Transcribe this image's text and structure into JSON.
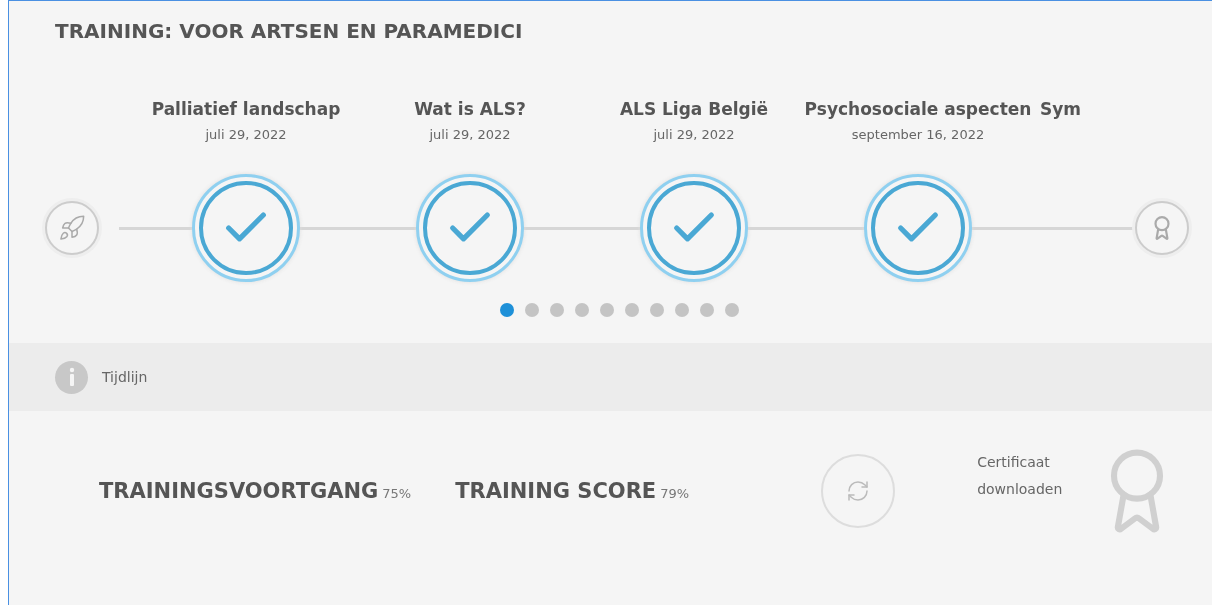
{
  "title": "TRAINING: VOOR ARTSEN EN PARAMEDICI",
  "steps": [
    {
      "title": "Palliatief landschap",
      "date": "juli 29, 2022",
      "completed": true
    },
    {
      "title": "Wat is ALS?",
      "date": "juli 29, 2022",
      "completed": true
    },
    {
      "title": "ALS Liga België",
      "date": "juli 29, 2022",
      "completed": true
    },
    {
      "title": "Psychosociale aspecten",
      "date": "september 16, 2022",
      "completed": true
    },
    {
      "title": "Sym"
    }
  ],
  "pagination": [
    {
      "selected": true
    },
    {
      "selected": false
    },
    {
      "selected": false
    },
    {
      "selected": false
    },
    {
      "selected": false
    },
    {
      "selected": false
    },
    {
      "selected": false
    },
    {
      "selected": false
    },
    {
      "selected": false
    },
    {
      "selected": false
    }
  ],
  "info_bar": {
    "label": "Tijdlijn"
  },
  "stats": [
    {
      "label": "TRAININGSVOORTGANG",
      "value": "75%"
    },
    {
      "label": "TRAINING SCORE",
      "value": "79%"
    }
  ],
  "certificate": {
    "label": "Certificaat downloaden"
  }
}
